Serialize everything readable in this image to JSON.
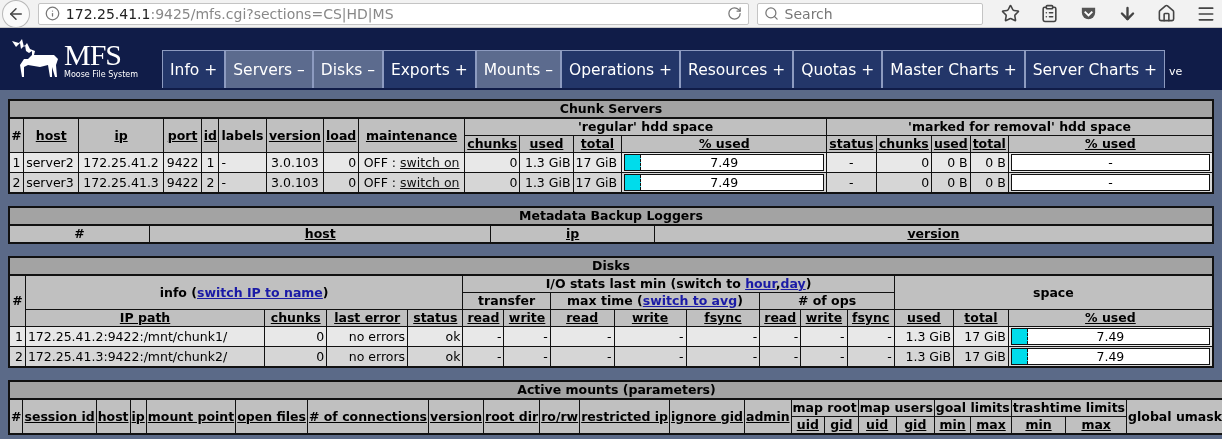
{
  "browser": {
    "url_host": "172.25.41.1",
    "url_rest": ":9425/mfs.cgi?sections=CS|HD|MS",
    "search": {
      "placeholder": "Search"
    }
  },
  "nav": {
    "logo": {
      "title": "MFS",
      "subtitle": "Moose File System"
    },
    "tabs": [
      {
        "label": "Info +",
        "selected": false
      },
      {
        "label": "Servers –",
        "selected": true
      },
      {
        "label": "Disks –",
        "selected": true
      },
      {
        "label": "Exports +",
        "selected": false
      },
      {
        "label": "Mounts –",
        "selected": true
      },
      {
        "label": "Operations +",
        "selected": false
      },
      {
        "label": "Resources +",
        "selected": false
      },
      {
        "label": "Quotas +",
        "selected": false
      },
      {
        "label": "Master Charts +",
        "selected": false
      },
      {
        "label": "Server Charts +",
        "selected": false
      }
    ],
    "cut_text": "ve"
  },
  "tables": [
    {
      "title": "Chunk Servers",
      "header_rows": [
        [
          {
            "text": "#",
            "rowspan": 2
          },
          {
            "text": "host",
            "sortable": true,
            "rowspan": 2
          },
          {
            "text": "ip",
            "sortable": true,
            "rowspan": 2
          },
          {
            "text": "port",
            "sortable": true,
            "rowspan": 2
          },
          {
            "text": "id",
            "sortable": true,
            "rowspan": 2
          },
          {
            "text": "labels",
            "rowspan": 2
          },
          {
            "text": "version",
            "sortable": true,
            "rowspan": 2
          },
          {
            "text": "load",
            "sortable": true,
            "rowspan": 2
          },
          {
            "text": "maintenance",
            "sortable": true,
            "rowspan": 2
          },
          {
            "text": "'regular' hdd space",
            "colspan": 4
          },
          {
            "text": "'marked for removal' hdd space",
            "colspan": 5
          }
        ],
        [
          {
            "text": "chunks",
            "sortable": true
          },
          {
            "text": "used",
            "sortable": true
          },
          {
            "text": "total",
            "sortable": true
          },
          {
            "text": "% used",
            "sortable": true
          },
          {
            "text": "status",
            "sortable": true
          },
          {
            "text": "chunks",
            "sortable": true
          },
          {
            "text": "used",
            "sortable": true
          },
          {
            "text": "total",
            "sortable": true
          },
          {
            "text": "% used",
            "sortable": true
          }
        ]
      ],
      "rows": [
        {
          "cells": [
            {
              "text": "1"
            },
            {
              "text": "server2",
              "kind": "label"
            },
            {
              "text": "172.25.41.2"
            },
            {
              "text": "9422"
            },
            {
              "text": "1"
            },
            {
              "text": "-",
              "kind": "label"
            },
            {
              "text": "3.0.103"
            },
            {
              "text": "0",
              "kind": "number"
            },
            {
              "parts": [
                {
                  "text": "OFF : "
                },
                {
                  "text": "switch on",
                  "kind": "action"
                }
              ]
            },
            {
              "text": "0",
              "kind": "number"
            },
            {
              "text": "1.3 GiB",
              "kind": "number"
            },
            {
              "text": "17 GiB",
              "kind": "label"
            },
            {
              "kind": "bar",
              "level": 0.0749,
              "text": "7.49"
            },
            {
              "text": "-"
            },
            {
              "text": "0",
              "kind": "number"
            },
            {
              "text": "0 B",
              "kind": "number"
            },
            {
              "text": "0 B",
              "kind": "number"
            },
            {
              "kind": "bar",
              "text": "-"
            }
          ]
        },
        {
          "cells": [
            {
              "text": "2"
            },
            {
              "text": "server3",
              "kind": "label"
            },
            {
              "text": "172.25.41.3"
            },
            {
              "text": "9422"
            },
            {
              "text": "2"
            },
            {
              "text": "-",
              "kind": "label"
            },
            {
              "text": "3.0.103"
            },
            {
              "text": "0",
              "kind": "number"
            },
            {
              "parts": [
                {
                  "text": "OFF : "
                },
                {
                  "text": "switch on",
                  "kind": "action"
                }
              ]
            },
            {
              "text": "0",
              "kind": "number"
            },
            {
              "text": "1.3 GiB",
              "kind": "number"
            },
            {
              "text": "17 GiB",
              "kind": "label"
            },
            {
              "kind": "bar",
              "level": 0.0749,
              "text": "7.49"
            },
            {
              "text": "-"
            },
            {
              "text": "0",
              "kind": "number"
            },
            {
              "text": "0 B",
              "kind": "number"
            },
            {
              "text": "0 B",
              "kind": "number"
            },
            {
              "kind": "bar",
              "text": "-"
            }
          ]
        }
      ]
    },
    {
      "title": "Metadata Backup Loggers",
      "header_rows": [
        [
          {
            "text": "#"
          },
          {
            "text": "host",
            "sortable": true
          },
          {
            "text": "ip",
            "sortable": true
          },
          {
            "text": "version",
            "sortable": true
          }
        ]
      ]
    },
    {
      "title": "Disks",
      "header_rows": [
        [
          {
            "text": "#",
            "rowspan": 3
          },
          {
            "parts": [
              {
                "text": "info ("
              },
              {
                "text": "switch IP to name",
                "kind": "link"
              },
              {
                "text": ")"
              }
            ],
            "colspan": 4,
            "rowspan": 2
          },
          {
            "parts": [
              {
                "text": "I/O stats last min (switch to "
              },
              {
                "text": "hour",
                "kind": "link"
              },
              {
                "text": ","
              },
              {
                "text": "day",
                "kind": "link"
              },
              {
                "text": ")"
              }
            ],
            "colspan": 8
          },
          {
            "text": "space",
            "colspan": 3,
            "rowspan": 2
          }
        ],
        [
          {
            "text": "transfer",
            "colspan": 2
          },
          {
            "parts": [
              {
                "text": "max time ("
              },
              {
                "text": "switch to avg",
                "kind": "link"
              },
              {
                "text": ")"
              }
            ],
            "colspan": 3
          },
          {
            "text": "# of ops",
            "colspan": 3
          }
        ],
        [
          {
            "text": "IP path",
            "sortable": true
          },
          {
            "text": "chunks",
            "sortable": true
          },
          {
            "text": "last error",
            "sortable": true
          },
          {
            "text": "status",
            "sortable": true
          },
          {
            "text": "read",
            "sortable": true
          },
          {
            "text": "write",
            "sortable": true
          },
          {
            "text": "read",
            "sortable": true
          },
          {
            "text": "write",
            "sortable": true
          },
          {
            "text": "fsync",
            "sortable": true
          },
          {
            "text": "read",
            "sortable": true
          },
          {
            "text": "write",
            "sortable": true
          },
          {
            "text": "fsync",
            "sortable": true
          },
          {
            "text": "used",
            "sortable": true
          },
          {
            "text": "total",
            "sortable": true
          },
          {
            "text": "% used",
            "sortable": true
          }
        ]
      ],
      "rows": [
        {
          "cells": [
            {
              "text": "1",
              "kind": "number"
            },
            {
              "text": "172.25.41.2:9422:/mnt/chunk1/",
              "kind": "label"
            },
            {
              "text": "0",
              "kind": "number"
            },
            {
              "text": "no errors",
              "kind": "number"
            },
            {
              "text": "ok",
              "kind": "number"
            },
            {
              "text": "-",
              "kind": "number"
            },
            {
              "text": "-",
              "kind": "number"
            },
            {
              "text": "-",
              "kind": "number"
            },
            {
              "text": "-",
              "kind": "number"
            },
            {
              "text": "-",
              "kind": "number"
            },
            {
              "text": "-",
              "kind": "number"
            },
            {
              "text": "-",
              "kind": "number"
            },
            {
              "text": "-",
              "kind": "number"
            },
            {
              "text": "1.3 GiB",
              "kind": "number"
            },
            {
              "text": "17 GiB",
              "kind": "number"
            },
            {
              "kind": "bar",
              "level": 0.0749,
              "text": "7.49"
            }
          ]
        },
        {
          "cells": [
            {
              "text": "2",
              "kind": "number"
            },
            {
              "text": "172.25.41.3:9422:/mnt/chunk2/",
              "kind": "label"
            },
            {
              "text": "0",
              "kind": "number"
            },
            {
              "text": "no errors",
              "kind": "number"
            },
            {
              "text": "ok",
              "kind": "number"
            },
            {
              "text": "-",
              "kind": "number"
            },
            {
              "text": "-",
              "kind": "number"
            },
            {
              "text": "-",
              "kind": "number"
            },
            {
              "text": "-",
              "kind": "number"
            },
            {
              "text": "-",
              "kind": "number"
            },
            {
              "text": "-",
              "kind": "number"
            },
            {
              "text": "-",
              "kind": "number"
            },
            {
              "text": "-",
              "kind": "number"
            },
            {
              "text": "1.3 GiB",
              "kind": "number"
            },
            {
              "text": "17 GiB",
              "kind": "number"
            },
            {
              "kind": "bar",
              "level": 0.0749,
              "text": "7.49"
            }
          ]
        }
      ]
    },
    {
      "title": "Active mounts (parameters)",
      "header_rows": [
        [
          {
            "text": "#",
            "rowspan": 2
          },
          {
            "text": "session id",
            "sortable": true,
            "rowspan": 2
          },
          {
            "text": "host",
            "sortable": true,
            "rowspan": 2
          },
          {
            "text": "ip",
            "sortable": true,
            "rowspan": 2
          },
          {
            "text": "mount point",
            "sortable": true,
            "rowspan": 2
          },
          {
            "text": "open files",
            "sortable": true,
            "rowspan": 2
          },
          {
            "text": "# of connections",
            "sortable": true,
            "rowspan": 2
          },
          {
            "text": "version",
            "sortable": true,
            "rowspan": 2
          },
          {
            "text": "root dir",
            "sortable": true,
            "rowspan": 2
          },
          {
            "text": "ro/rw",
            "sortable": true,
            "rowspan": 2
          },
          {
            "text": "restricted ip",
            "sortable": true,
            "rowspan": 2
          },
          {
            "text": "ignore gid",
            "sortable": true,
            "rowspan": 2
          },
          {
            "text": "admin",
            "sortable": true,
            "rowspan": 2
          },
          {
            "text": "map root",
            "colspan": 2
          },
          {
            "text": "map users",
            "colspan": 2
          },
          {
            "text": "goal limits",
            "colspan": 2
          },
          {
            "text": "trashtime limits",
            "colspan": 2
          },
          {
            "text": "global umask",
            "rowspan": 2
          }
        ],
        [
          {
            "text": "uid",
            "sortable": true
          },
          {
            "text": "gid",
            "sortable": true
          },
          {
            "text": "uid",
            "sortable": true
          },
          {
            "text": "gid",
            "sortable": true
          },
          {
            "text": "min",
            "sortable": true
          },
          {
            "text": "max",
            "sortable": true
          },
          {
            "text": "min",
            "sortable": true
          },
          {
            "text": "max",
            "sortable": true
          }
        ]
      ]
    }
  ]
}
